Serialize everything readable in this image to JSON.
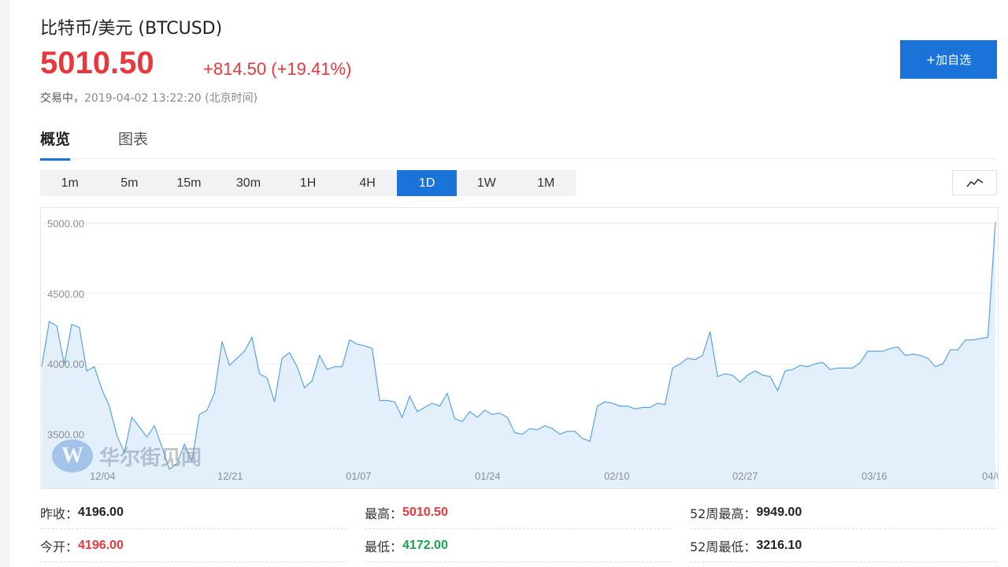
{
  "header": {
    "title": "比特币/美元  (BTCUSD)",
    "price": "5010.50",
    "change": "+814.50 (+19.41%)",
    "status": "交易中，",
    "timestamp": "2019-04-02 13:22:20  (北京时间)",
    "add_button": "+加自选"
  },
  "tabs": [
    {
      "label": "概览",
      "active": true
    },
    {
      "label": "图表",
      "active": false
    }
  ],
  "periods": [
    {
      "label": "1m",
      "active": false
    },
    {
      "label": "5m",
      "active": false
    },
    {
      "label": "15m",
      "active": false
    },
    {
      "label": "30m",
      "active": false
    },
    {
      "label": "1H",
      "active": false
    },
    {
      "label": "4H",
      "active": false
    },
    {
      "label": "1D",
      "active": true
    },
    {
      "label": "1W",
      "active": false
    },
    {
      "label": "1M",
      "active": false
    }
  ],
  "watermark": {
    "text": "华尔街见闻",
    "logo": "W"
  },
  "colors": {
    "accent": "#1a73d9",
    "up": "#e8383d",
    "down": "#1aa34a",
    "line": "#5aa2e8",
    "area": "#e3f0fc"
  },
  "chart_data": {
    "type": "area",
    "x_ticks": [
      "12/04",
      "12/21",
      "01/07",
      "01/24",
      "02/10",
      "02/27",
      "03/16",
      "04/0"
    ],
    "y_ticks": [
      "5000.00",
      "4500.00",
      "4000.00",
      "3500.00"
    ],
    "ylim": [
      3115,
      5110
    ],
    "grid": true,
    "values": [
      3980,
      4300,
      4270,
      4000,
      4280,
      4260,
      3950,
      3980,
      3820,
      3700,
      3490,
      3370,
      3620,
      3550,
      3480,
      3560,
      3410,
      3250,
      3290,
      3430,
      3310,
      3640,
      3670,
      3790,
      4160,
      3990,
      4040,
      4090,
      4190,
      3930,
      3900,
      3730,
      4040,
      4080,
      3980,
      3830,
      3880,
      4060,
      3960,
      3980,
      3980,
      4170,
      4140,
      4130,
      4110,
      3740,
      3740,
      3730,
      3620,
      3770,
      3660,
      3690,
      3720,
      3700,
      3790,
      3610,
      3590,
      3660,
      3620,
      3670,
      3640,
      3650,
      3620,
      3510,
      3500,
      3540,
      3530,
      3560,
      3540,
      3500,
      3520,
      3520,
      3470,
      3450,
      3700,
      3730,
      3720,
      3700,
      3700,
      3680,
      3690,
      3690,
      3720,
      3710,
      3970,
      4000,
      4040,
      4030,
      4060,
      4230,
      3910,
      3930,
      3920,
      3870,
      3920,
      3950,
      3920,
      3910,
      3810,
      3950,
      3960,
      3990,
      3980,
      4000,
      4010,
      3960,
      3970,
      3970,
      3970,
      4010,
      4090,
      4090,
      4090,
      4110,
      4120,
      4060,
      4070,
      4060,
      4040,
      3980,
      4000,
      4100,
      4100,
      4170,
      4170,
      4180,
      4190,
      5010
    ]
  },
  "stats": [
    {
      "label": "昨收：",
      "value": "4196.00",
      "color": "black"
    },
    {
      "label": "最高：",
      "value": "5010.50",
      "color": "red"
    },
    {
      "label": "52周最高：",
      "value": "9949.00",
      "color": "black"
    },
    {
      "label": "今开：",
      "value": "4196.00",
      "color": "red"
    },
    {
      "label": "最低：",
      "value": "4172.00",
      "color": "green"
    },
    {
      "label": "52周最低：",
      "value": "3216.10",
      "color": "black"
    }
  ]
}
